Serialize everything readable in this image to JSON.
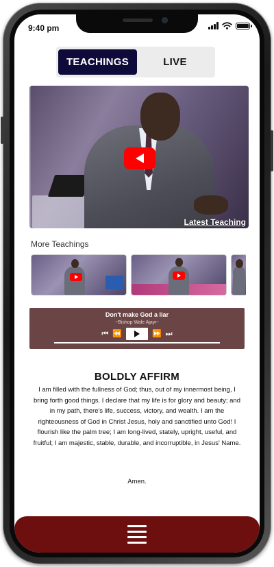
{
  "status_bar": {
    "time": "9:40 pm"
  },
  "tabs": {
    "teachings_label": "TEACHINGS",
    "live_label": "LIVE"
  },
  "hero": {
    "caption": "Latest Teaching"
  },
  "more_teachings": {
    "title": "More Teachings"
  },
  "player": {
    "title": "Don't make God a liar",
    "subtitle": "~Bishop Wale Ajayi~",
    "controls": {
      "skip_back": "⏮",
      "rewind": "⏪",
      "forward": "⏩",
      "skip_forward": "⏭"
    }
  },
  "affirmation": {
    "title": "BOLDLY AFFIRM",
    "body": "I am filled with the fullness of God; thus, out of my innermost being, I bring forth good things. I declare that my life is for glory and beauty; and in my path, there's life, success, victory, and wealth. I am the righteousness of God in Christ Jesus, holy and sanctified unto God! I flourish like the palm tree; I am long-lived, stately, upright, useful, and fruitful; I am majestic, stable, durable, and incorruptible, in Jesus' Name.",
    "amen": "Amen."
  },
  "colors": {
    "tab_active": "#0e0b3b",
    "player_bg": "#6b4545",
    "bottom_bar": "#6e0f0f",
    "youtube_red": "#ff0000"
  },
  "icons": {
    "menu": "hamburger-icon",
    "play": "play-icon",
    "battery": "battery-icon",
    "wifi": "wifi-icon",
    "signal": "signal-icon"
  }
}
